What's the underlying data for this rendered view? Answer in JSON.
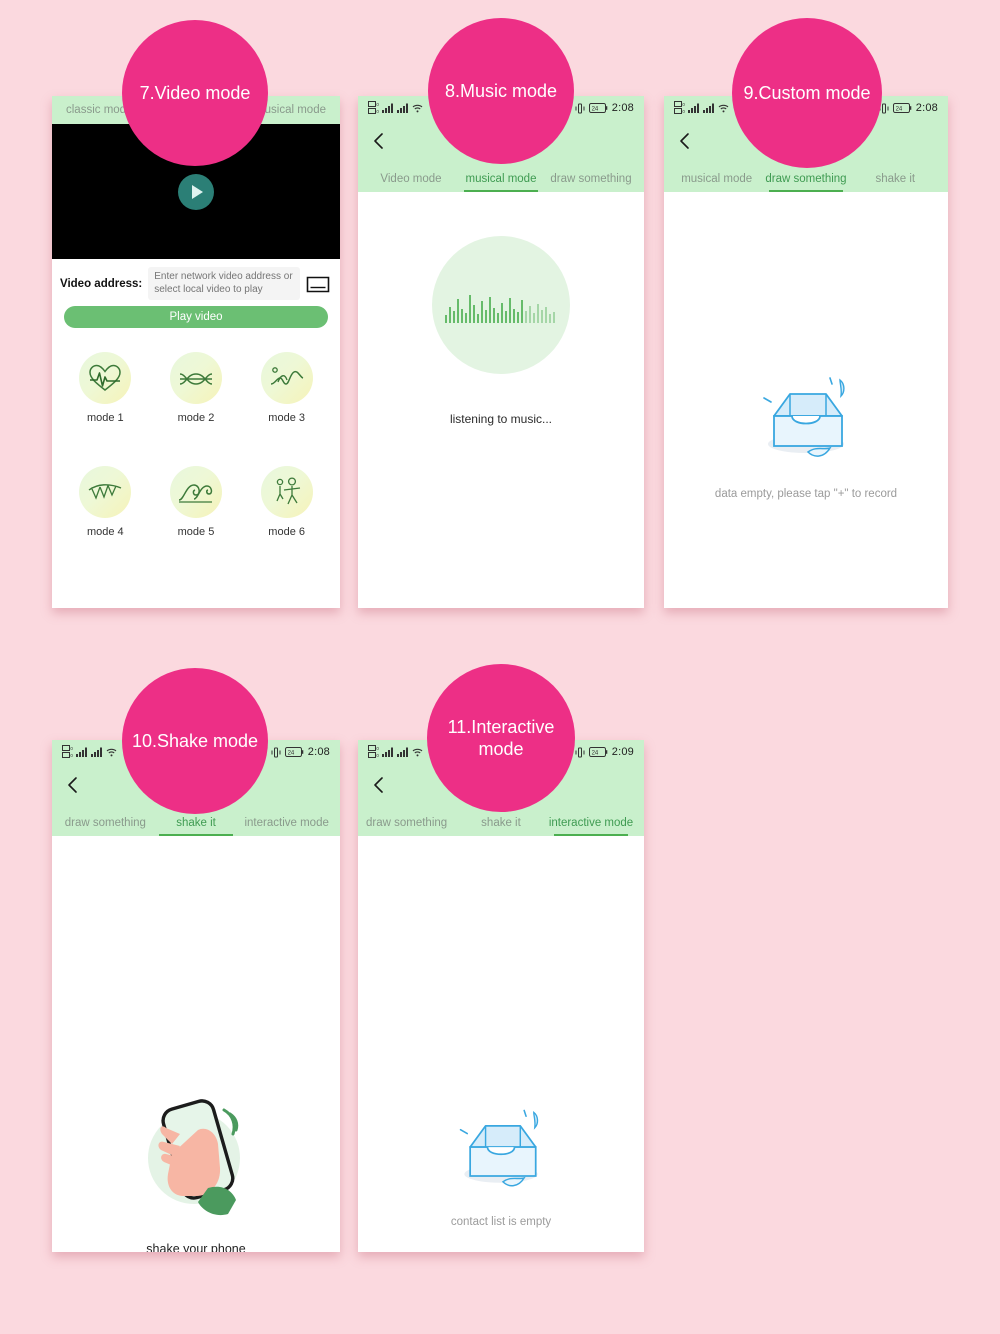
{
  "page": {
    "background_color": "#fbd9df",
    "badge_color": "#ed2f86",
    "accent_green": "#4caf50",
    "header_green": "#c9f0cc"
  },
  "badges": [
    {
      "id": "badge-video",
      "label": "7.Video mode"
    },
    {
      "id": "badge-music",
      "label": "8.Music mode"
    },
    {
      "id": "badge-custom",
      "label": "9.Custom mode"
    },
    {
      "id": "badge-shake",
      "label": "10.Shake mode"
    },
    {
      "id": "badge-interactive",
      "label": "11.Interactive mode"
    }
  ],
  "panels": {
    "video": {
      "tabs": {
        "left": "classic mode",
        "right": "musical mode"
      },
      "video_player": {
        "play_icon": "play-icon"
      },
      "address": {
        "label": "Video address:",
        "placeholder": "Enter network video address or select local video to play",
        "value": "",
        "browse_icon": "folder-icon"
      },
      "play_button": "Play video",
      "modes": [
        {
          "label": "mode 1",
          "icon": "heartbeat-icon"
        },
        {
          "label": "mode 2",
          "icon": "wave-knot-icon"
        },
        {
          "label": "mode 3",
          "icon": "music-wave-icon"
        },
        {
          "label": "mode 4",
          "icon": "bunting-flags-icon"
        },
        {
          "label": "mode 5",
          "icon": "ocean-wave-icon"
        },
        {
          "label": "mode 6",
          "icon": "dancing-people-icon"
        }
      ]
    },
    "music": {
      "statusbar": {
        "time": "2:08",
        "battery": "24"
      },
      "back_icon": "back-chevron-icon",
      "tabs": [
        {
          "label": "Video mode",
          "active": false
        },
        {
          "label": "musical mode",
          "active": true
        },
        {
          "label": "draw something",
          "active": false
        }
      ],
      "visualizer_icon": "audio-bars-icon",
      "caption": "listening to music..."
    },
    "custom": {
      "statusbar": {
        "time": "2:08",
        "battery": "24"
      },
      "back_icon": "back-chevron-icon",
      "tabs": [
        {
          "label": "musical mode",
          "active": false
        },
        {
          "label": "draw something",
          "active": true
        },
        {
          "label": "shake it",
          "active": false
        }
      ],
      "empty_icon": "empty-inbox-icon",
      "caption": "data empty, please tap \"+\" to record"
    },
    "shake": {
      "statusbar": {
        "time": "2:08",
        "battery": "24"
      },
      "back_icon": "back-chevron-icon",
      "tabs": [
        {
          "label": "draw something",
          "active": false
        },
        {
          "label": "shake it",
          "active": true
        },
        {
          "label": "interactive mode",
          "active": false
        }
      ],
      "illustration_icon": "hand-holding-phone-icon",
      "caption": "shake your phone"
    },
    "interactive": {
      "statusbar": {
        "time": "2:09",
        "battery": "24"
      },
      "back_icon": "back-chevron-icon",
      "tabs": [
        {
          "label": "draw something",
          "active": false
        },
        {
          "label": "shake it",
          "active": false
        },
        {
          "label": "interactive mode",
          "active": true
        }
      ],
      "empty_icon": "empty-inbox-icon",
      "caption": "contact list is empty"
    }
  }
}
